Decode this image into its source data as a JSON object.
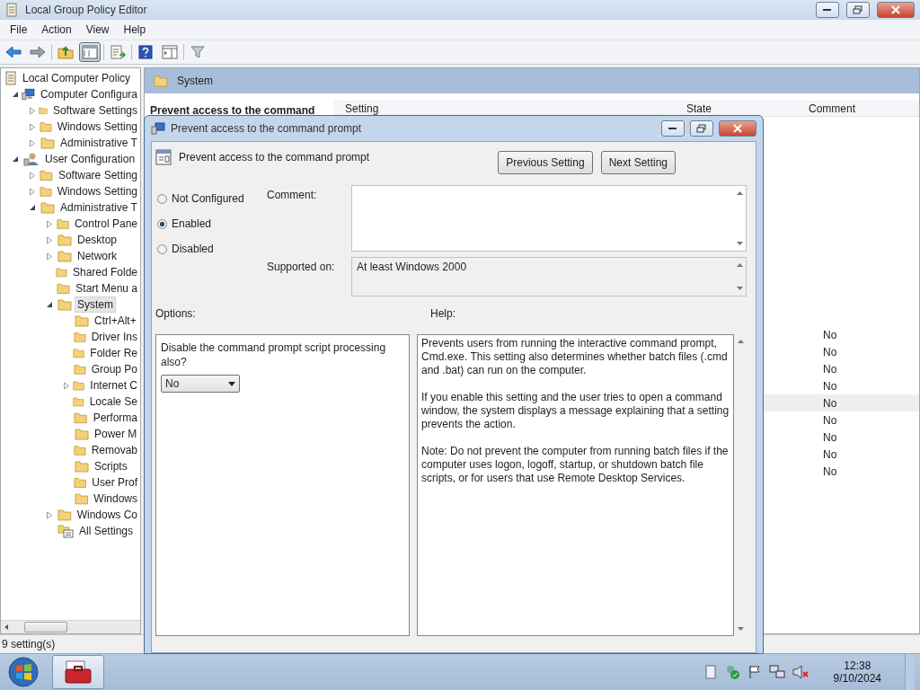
{
  "window": {
    "title": "Local Group Policy Editor"
  },
  "menu": [
    "File",
    "Action",
    "View",
    "Help"
  ],
  "toolbar": [
    {
      "kind": "back",
      "pressed": false
    },
    {
      "kind": "forward",
      "pressed": false
    },
    {
      "kind": "up",
      "pressed": false
    },
    {
      "kind": "tree",
      "pressed": true
    },
    {
      "kind": "export",
      "pressed": false
    },
    {
      "kind": "help",
      "pressed": false
    },
    {
      "kind": "pane",
      "pressed": false
    },
    {
      "kind": "filter",
      "pressed": false
    }
  ],
  "tree": [
    {
      "label": "Local Computer Policy",
      "kind": "policy",
      "selected": false,
      "children": [
        {
          "label": "Computer Configura",
          "kind": "computer",
          "selected": false,
          "expanded": true,
          "children": [
            {
              "label": "Software Settings",
              "kind": "folder",
              "selected": false,
              "expanded": false
            },
            {
              "label": "Windows Setting",
              "kind": "folder",
              "selected": false,
              "expanded": false
            },
            {
              "label": "Administrative T",
              "kind": "folder",
              "selected": false,
              "expanded": false
            }
          ]
        },
        {
          "label": "User Configuration",
          "kind": "user",
          "selected": false,
          "expanded": true,
          "children": [
            {
              "label": "Software Setting",
              "kind": "folder",
              "selected": false,
              "expanded": false
            },
            {
              "label": "Windows Setting",
              "kind": "folder",
              "selected": false,
              "expanded": false
            },
            {
              "label": "Administrative T",
              "kind": "folder",
              "selected": false,
              "expanded": true,
              "children": [
                {
                  "label": "Control Pane",
                  "kind": "folder",
                  "selected": false,
                  "expanded": false
                },
                {
                  "label": "Desktop",
                  "kind": "folder",
                  "selected": false,
                  "expanded": false
                },
                {
                  "label": "Network",
                  "kind": "folder",
                  "selected": false,
                  "expanded": false
                },
                {
                  "label": "Shared Folde",
                  "kind": "folder",
                  "selected": false
                },
                {
                  "label": "Start Menu a",
                  "kind": "folder",
                  "selected": false
                },
                {
                  "label": "System",
                  "kind": "folder",
                  "selected": true,
                  "expanded": true,
                  "children": [
                    {
                      "label": "Ctrl+Alt+",
                      "kind": "folder",
                      "selected": false
                    },
                    {
                      "label": "Driver Ins",
                      "kind": "folder",
                      "selected": false
                    },
                    {
                      "label": "Folder Re",
                      "kind": "folder",
                      "selected": false
                    },
                    {
                      "label": "Group Po",
                      "kind": "folder",
                      "selected": false
                    },
                    {
                      "label": "Internet C",
                      "kind": "folder",
                      "selected": false,
                      "expanded": false
                    },
                    {
                      "label": "Locale Se",
                      "kind": "folder",
                      "selected": false
                    },
                    {
                      "label": "Performa",
                      "kind": "folder",
                      "selected": false
                    },
                    {
                      "label": "Power M",
                      "kind": "folder",
                      "selected": false
                    },
                    {
                      "label": "Removab",
                      "kind": "folder",
                      "selected": false
                    },
                    {
                      "label": "Scripts",
                      "kind": "folder",
                      "selected": false
                    },
                    {
                      "label": "User Prof",
                      "kind": "folder",
                      "selected": false
                    },
                    {
                      "label": "Windows",
                      "kind": "folder",
                      "selected": false
                    }
                  ]
                },
                {
                  "label": "Windows Co",
                  "kind": "folder",
                  "selected": false,
                  "expanded": false
                },
                {
                  "label": "All Settings",
                  "kind": "settings",
                  "selected": false
                }
              ]
            }
          ]
        }
      ]
    }
  ],
  "pane": {
    "title": "System",
    "description_title": "Prevent access to the command",
    "columns": [
      "Setting",
      "State",
      "Comment"
    ],
    "rows": [
      {
        "comment": "No",
        "selected": false
      },
      {
        "comment": "No",
        "selected": false
      },
      {
        "comment": "No",
        "selected": false
      },
      {
        "comment": "No",
        "selected": false
      },
      {
        "comment": "No",
        "selected": true
      },
      {
        "comment": "No",
        "selected": false
      },
      {
        "comment": "No",
        "selected": false
      },
      {
        "comment": "No",
        "selected": false
      },
      {
        "comment": "No",
        "selected": false
      }
    ]
  },
  "status_bar": "9 setting(s)",
  "dialog": {
    "title": "Prevent access to the command prompt",
    "heading": "Prevent access to the command prompt",
    "buttons": [
      "Previous Setting",
      "Next Setting"
    ],
    "settings": [
      {
        "label": "Not Configured",
        "selected": false
      },
      {
        "label": "Enabled",
        "selected": true
      },
      {
        "label": "Disabled",
        "selected": false
      }
    ],
    "comment_label": "Comment:",
    "supported_label": "Supported on:",
    "supported_value": "At least Windows 2000",
    "options_label": "Options:",
    "help_label": "Help:",
    "option_question": "Disable the command prompt script processing also?",
    "option_value": "No",
    "help": [
      "Prevents users from running the interactive command prompt, Cmd.exe. This setting also determines whether batch files (.cmd and .bat) can run on the computer.",
      "If you enable this setting and the user tries to open a command window, the system displays a message explaining that a setting prevents the action.",
      "Note: Do not prevent the computer from running batch files if the computer uses logon, logoff, startup, or shutdown batch file scripts, or for users that use Remote Desktop Services."
    ]
  },
  "taskbar": {
    "time": "12:38",
    "date": "9/10/2024",
    "app_active": true
  }
}
